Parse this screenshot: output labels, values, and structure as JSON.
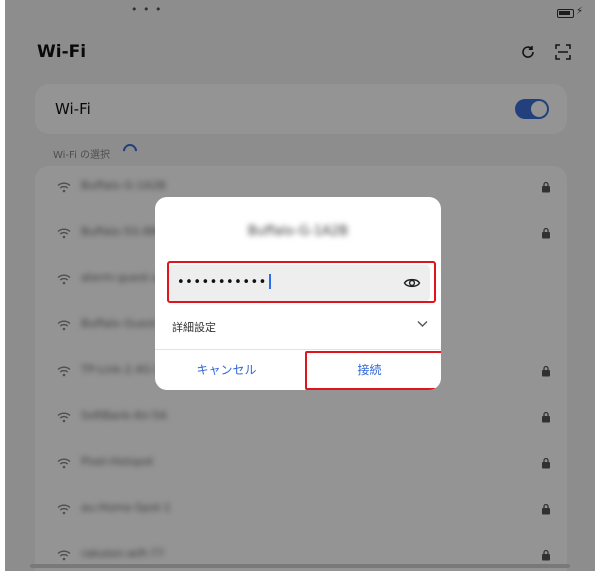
{
  "statusbar": {
    "dots": "• • •"
  },
  "header": {
    "title": "Wi-Fi"
  },
  "wifi_toggle": {
    "label": "Wi-Fi",
    "enabled": true
  },
  "section": {
    "label": "Wi-Fi の選択"
  },
  "networks": [
    {
      "name": "Buffalo-G-1A2B",
      "locked": true
    },
    {
      "name": "Buffalo-5G-88C1",
      "locked": true
    },
    {
      "name": "aterm-guest-a3b",
      "locked": false
    },
    {
      "name": "Buffalo-Guest-01",
      "locked": false
    },
    {
      "name": "TP-Link-2.4G-55",
      "locked": true
    },
    {
      "name": "SoftBank-Air-5A",
      "locked": true
    },
    {
      "name": "Pixel-Hotspot",
      "locked": true
    },
    {
      "name": "au-Home-Spot-1",
      "locked": true
    },
    {
      "name": "rakuten-wifi-77",
      "locked": true
    }
  ],
  "dialog": {
    "title": "Buffalo-G-1A2B",
    "password_value": "•••••••••••",
    "advanced_label": "詳細設定",
    "cancel_label": "キャンセル",
    "connect_label": "接続"
  },
  "colors": {
    "accent": "#3b6fd6",
    "highlight": "#e0141b",
    "dialog_button_text": "#2f66d5"
  },
  "icons": {
    "refresh": "refresh-icon",
    "scan": "qr-scan-icon",
    "wifi": "wifi-icon",
    "lock": "lock-icon",
    "eye": "eye-icon",
    "chevron": "chevron-down-icon"
  }
}
